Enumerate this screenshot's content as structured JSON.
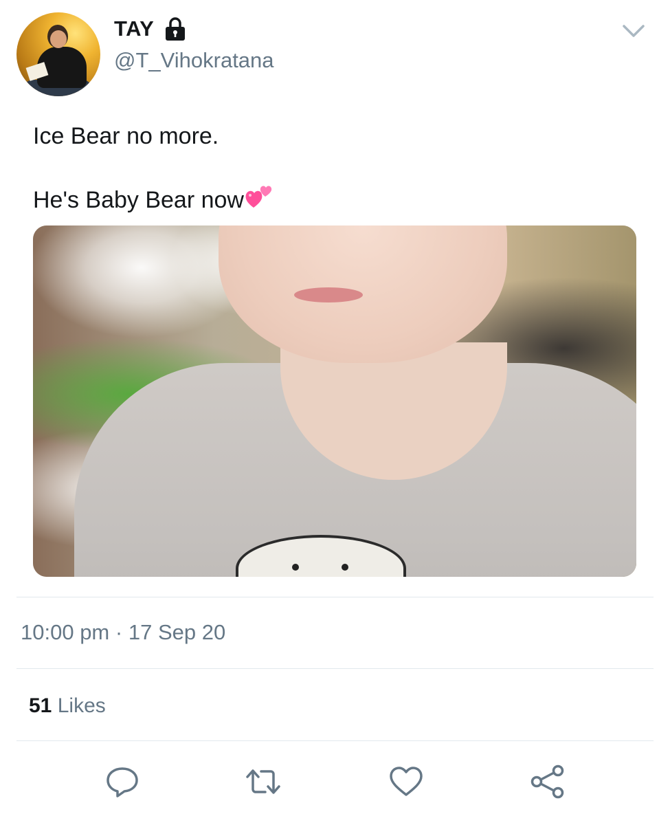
{
  "user": {
    "display_name": "TAY",
    "handle": "@T_Vihokratana",
    "protected_icon": "lock-icon",
    "avatar_icon": "profile-photo"
  },
  "tweet": {
    "line1": "Ice Bear no more.",
    "line2": "He's Baby Bear now",
    "line2_emoji": "two-hearts-emoji",
    "media_description_icon": "photo"
  },
  "meta": {
    "time": "10:00 pm",
    "separator": "·",
    "date": "17 Sep 20",
    "likes_count": "51",
    "likes_label": "Likes"
  },
  "actions": [
    "reply-icon",
    "retweet-icon",
    "like-icon",
    "share-icon"
  ],
  "colors": {
    "text_primary": "#14171a",
    "text_secondary": "#657786",
    "divider": "#e1e8ed",
    "icon": "#657786",
    "heart_emoji": "#ff5fa2"
  }
}
